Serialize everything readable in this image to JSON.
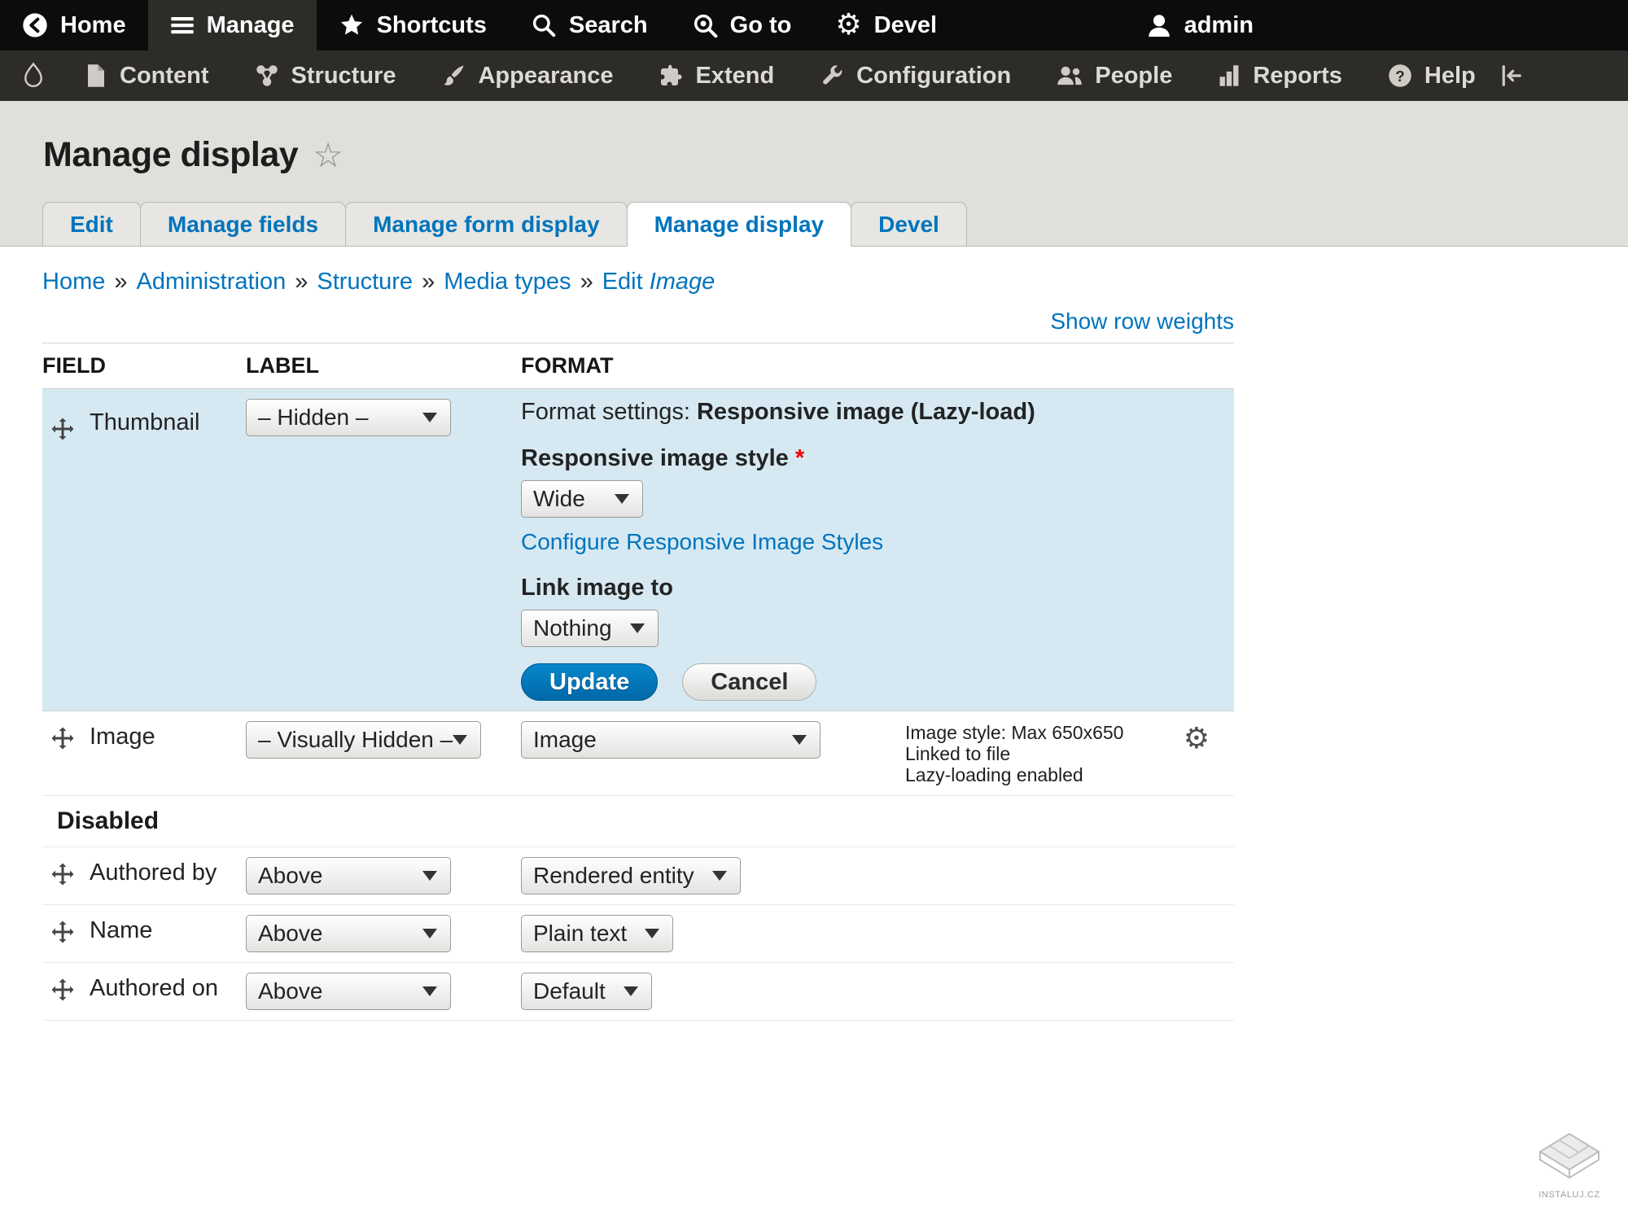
{
  "topbar": {
    "items": [
      {
        "label": "Home",
        "icon": "home-back-icon"
      },
      {
        "label": "Manage",
        "icon": "hamburger-icon",
        "active": true
      },
      {
        "label": "Shortcuts",
        "icon": "star-icon"
      },
      {
        "label": "Search",
        "icon": "search-icon"
      },
      {
        "label": "Go to",
        "icon": "goto-icon"
      },
      {
        "label": "Devel",
        "icon": "gear-icon"
      }
    ],
    "user": "admin"
  },
  "traybar": {
    "items": [
      {
        "label": "Content",
        "icon": "file-icon"
      },
      {
        "label": "Structure",
        "icon": "structure-icon"
      },
      {
        "label": "Appearance",
        "icon": "paintbrush-icon"
      },
      {
        "label": "Extend",
        "icon": "puzzle-icon"
      },
      {
        "label": "Configuration",
        "icon": "wrench-icon"
      },
      {
        "label": "People",
        "icon": "people-icon"
      },
      {
        "label": "Reports",
        "icon": "bar-chart-icon"
      },
      {
        "label": "Help",
        "icon": "help-icon"
      }
    ]
  },
  "page": {
    "title": "Manage display"
  },
  "tabs": {
    "items": [
      {
        "label": "Edit"
      },
      {
        "label": "Manage fields"
      },
      {
        "label": "Manage form display"
      },
      {
        "label": "Manage display",
        "active": true
      },
      {
        "label": "Devel"
      }
    ]
  },
  "breadcrumb": {
    "separator": "»",
    "items": [
      "Home",
      "Administration",
      "Structure",
      "Media types"
    ],
    "current": {
      "prefix": "Edit",
      "emphasis": "Image"
    }
  },
  "actions": {
    "show_row_weights": "Show row weights"
  },
  "table": {
    "headers": {
      "field": "FIELD",
      "label": "LABEL",
      "format": "FORMAT"
    },
    "thumbnail_row": {
      "field": "Thumbnail",
      "label_value": "– Hidden –",
      "settings": {
        "title_prefix": "Format settings:",
        "title_value": "Responsive image (Lazy-load)",
        "style_label": "Responsive image style",
        "required_mark": "*",
        "style_value": "Wide",
        "configure_link": "Configure Responsive Image Styles",
        "link_label": "Link image to",
        "link_value": "Nothing",
        "update": "Update",
        "cancel": "Cancel"
      }
    },
    "image_row": {
      "field": "Image",
      "label_value": "– Visually Hidden –",
      "format_value": "Image",
      "summary": [
        "Image style: Max 650x650",
        "Linked to file",
        "Lazy-loading enabled"
      ]
    },
    "disabled_heading": "Disabled",
    "disabled_rows": [
      {
        "field": "Authored by",
        "label_value": "Above",
        "format_value": "Rendered entity"
      },
      {
        "field": "Name",
        "label_value": "Above",
        "format_value": "Plain text"
      },
      {
        "field": "Authored on",
        "label_value": "Above",
        "format_value": "Default"
      }
    ]
  },
  "watermark": {
    "text": "INSTALUJ.CZ"
  },
  "colors": {
    "link": "#0074bd",
    "primary_button": "#0071b8",
    "row_highlight": "#d6e9f3",
    "required": "#ee0000",
    "toolbar_bg": "#0c0c0c",
    "tray_bg": "#2e2c28"
  }
}
